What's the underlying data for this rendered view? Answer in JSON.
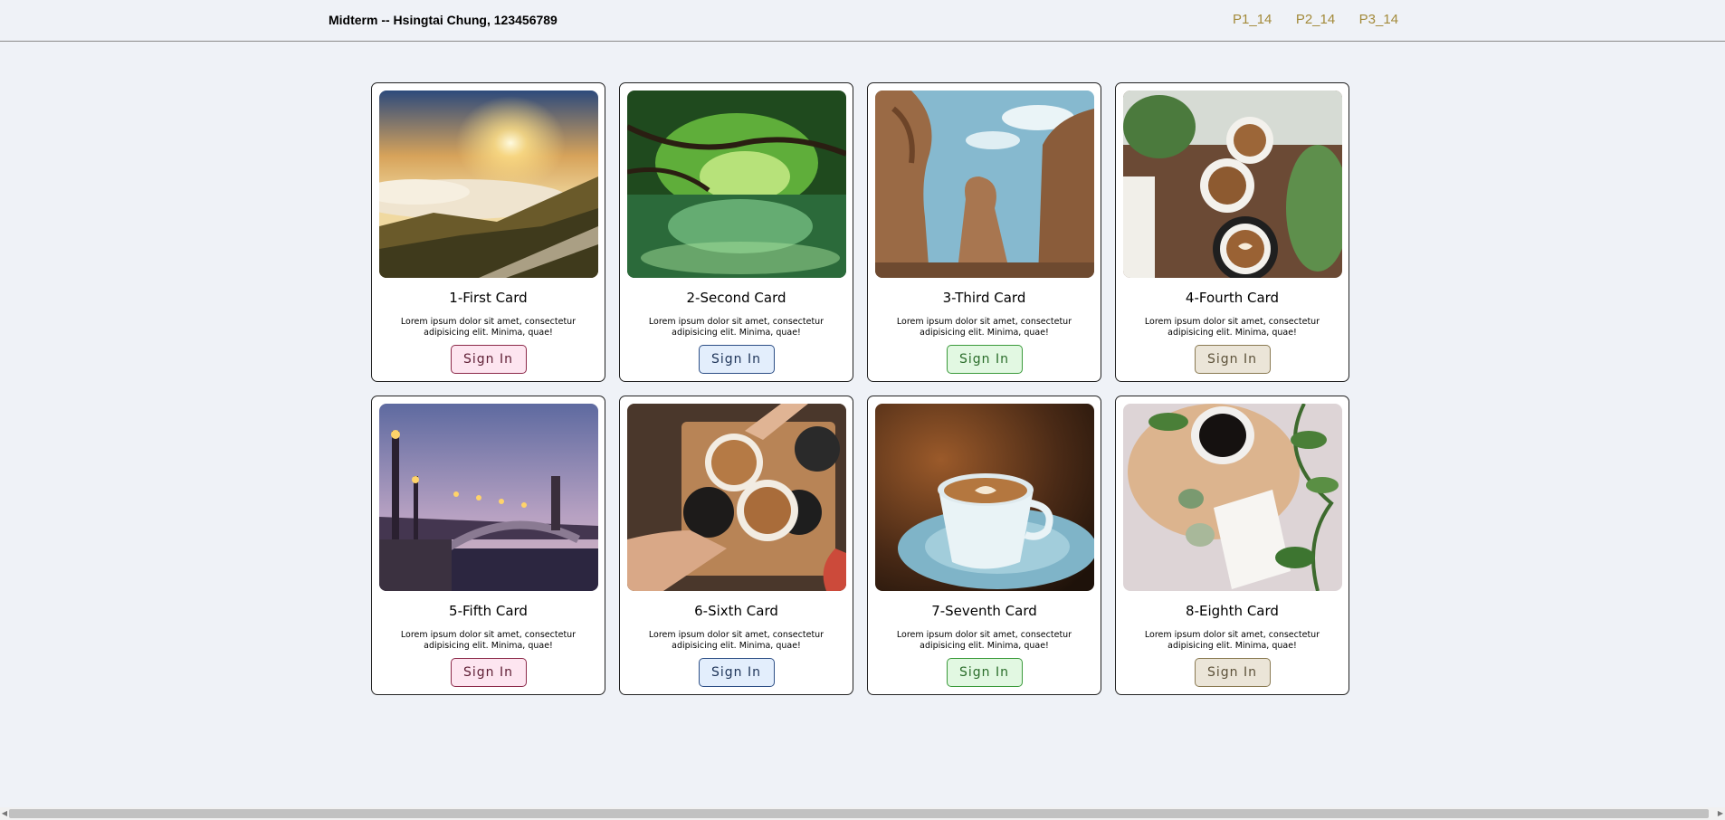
{
  "navbar": {
    "brand": "Midterm -- Hsingtai Chung, 123456789",
    "links": [
      "P1_14",
      "P2_14",
      "P3_14"
    ]
  },
  "cards": [
    {
      "title": "1-First Card",
      "text": "Lorem ipsum dolor sit amet, consectetur adipisicing elit. Minima, quae!",
      "button": "Sign In",
      "image": "sunrise-mountains"
    },
    {
      "title": "2-Second Card",
      "text": "Lorem ipsum dolor sit amet, consectetur adipisicing elit. Minima, quae!",
      "button": "Sign In",
      "image": "tree-tunnel-river"
    },
    {
      "title": "3-Third Card",
      "text": "Lorem ipsum dolor sit amet, consectetur adipisicing elit. Minima, quae!",
      "button": "Sign In",
      "image": "rock-formations"
    },
    {
      "title": "4-Fourth Card",
      "text": "Lorem ipsum dolor sit amet, consectetur adipisicing elit. Minima, quae!",
      "button": "Sign In",
      "image": "latte-cups-plants"
    },
    {
      "title": "5-Fifth Card",
      "text": "Lorem ipsum dolor sit amet, consectetur adipisicing elit. Minima, quae!",
      "button": "Sign In",
      "image": "bridge-dusk"
    },
    {
      "title": "6-Sixth Card",
      "text": "Lorem ipsum dolor sit amet, consectetur adipisicing elit. Minima, quae!",
      "button": "Sign In",
      "image": "coffee-cheers"
    },
    {
      "title": "7-Seventh Card",
      "text": "Lorem ipsum dolor sit amet, consectetur adipisicing elit. Minima, quae!",
      "button": "Sign In",
      "image": "cappuccino-blue-cup"
    },
    {
      "title": "8-Eighth Card",
      "text": "Lorem ipsum dolor sit amet, consectetur adipisicing elit. Minima, quae!",
      "button": "Sign In",
      "image": "coffee-enjoy-note"
    }
  ],
  "colors": {
    "background": "#eff2f7",
    "nav_link": "#a38a3a",
    "button_pink": "#fde5f0",
    "button_blue": "#e3eefc",
    "button_green": "#e2f8e2",
    "button_tan": "#ebe5d8"
  }
}
